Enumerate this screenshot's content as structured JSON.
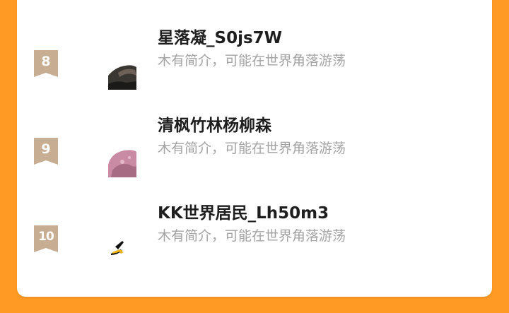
{
  "colors": {
    "background": "#ff9a24",
    "card": "#ffffff",
    "rank_badge": "#c7ad92",
    "name_text": "#1e1e1e",
    "bio_text": "#a3a3a3"
  },
  "leaderboard": {
    "rows": [
      {
        "rank": "8",
        "name": "星落凝_S0js7W",
        "bio": "木有简介，可能在世界角落游荡",
        "avatar_icon": "dark-rock-avatar"
      },
      {
        "rank": "9",
        "name": "清枫竹林杨柳森",
        "bio": "木有简介，可能在世界角落游荡",
        "avatar_icon": "pink-flower-avatar"
      },
      {
        "rank": "10",
        "name": "KK世界居民_Lh50m3",
        "bio": "木有简介，可能在世界角落游荡",
        "avatar_icon": "high-heel-avatar"
      }
    ]
  }
}
